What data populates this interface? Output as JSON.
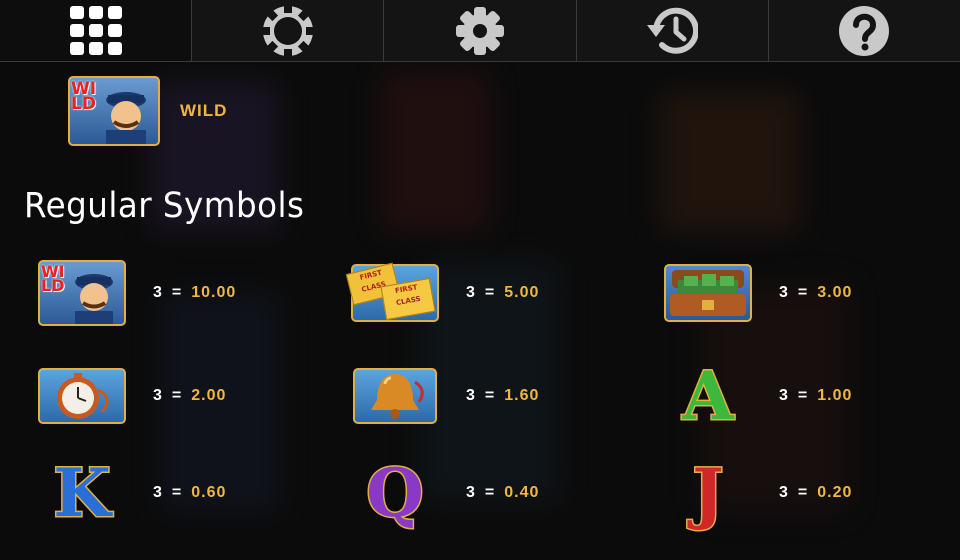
{
  "nav": {
    "tabs": [
      {
        "icon": "grid-icon",
        "active": true
      },
      {
        "icon": "chip-icon",
        "active": false
      },
      {
        "icon": "gear-icon",
        "active": false
      },
      {
        "icon": "history-icon",
        "active": false
      },
      {
        "icon": "question-icon",
        "active": false
      }
    ]
  },
  "wild": {
    "label": "WILD",
    "badge_text": "WILD"
  },
  "section_title": "Regular Symbols",
  "symbols": [
    {
      "icon": "wild-conductor-icon",
      "count": "3",
      "eq": "=",
      "value": "10.00"
    },
    {
      "icon": "first-class-tickets-icon",
      "count": "3",
      "eq": "=",
      "value": "5.00",
      "ticket_text": "FIRST CLASS"
    },
    {
      "icon": "money-suitcase-icon",
      "count": "3",
      "eq": "=",
      "value": "3.00"
    },
    {
      "icon": "pocket-watch-icon",
      "count": "3",
      "eq": "=",
      "value": "2.00"
    },
    {
      "icon": "bell-icon",
      "count": "3",
      "eq": "=",
      "value": "1.60"
    },
    {
      "icon": "letter-a-icon",
      "letter": "A",
      "count": "3",
      "eq": "=",
      "value": "1.00"
    },
    {
      "icon": "letter-k-icon",
      "letter": "K",
      "count": "3",
      "eq": "=",
      "value": "0.60"
    },
    {
      "icon": "letter-q-icon",
      "letter": "Q",
      "count": "3",
      "eq": "=",
      "value": "0.40"
    },
    {
      "icon": "letter-j-icon",
      "letter": "J",
      "count": "3",
      "eq": "=",
      "value": "0.20"
    }
  ],
  "colors": {
    "accent": "#f0b640",
    "text": "#ffffff",
    "background": "#0b0b0b",
    "nav_icon": "#c9c9c9"
  }
}
